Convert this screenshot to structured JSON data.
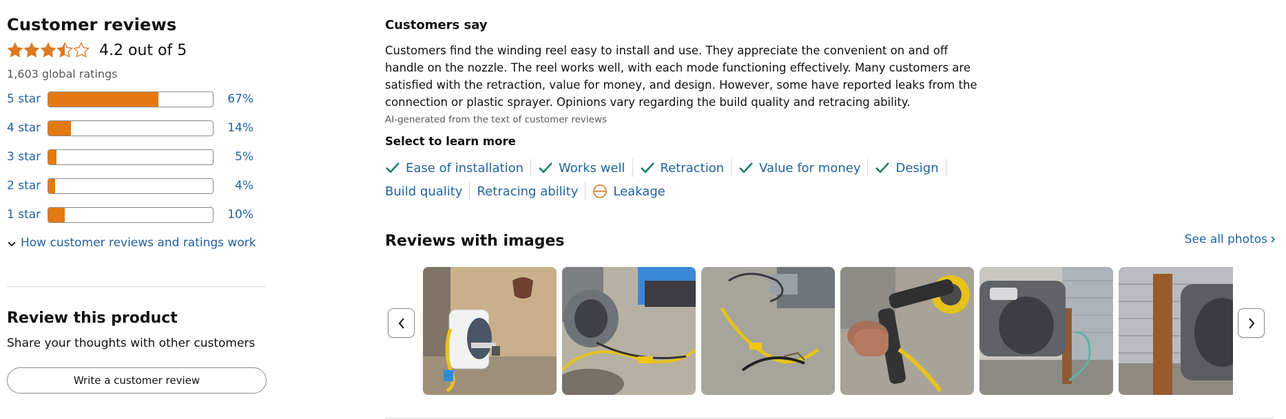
{
  "summary": {
    "title": "Customer reviews",
    "rating_text": "4.2 out of 5",
    "rating_value": 4.2,
    "global_ratings": "1,603 global ratings",
    "histogram": [
      {
        "label": "5 star",
        "pct": "67%",
        "value": 67
      },
      {
        "label": "4 star",
        "pct": "14%",
        "value": 14
      },
      {
        "label": "3 star",
        "pct": "5%",
        "value": 5
      },
      {
        "label": "2 star",
        "pct": "4%",
        "value": 4
      },
      {
        "label": "1 star",
        "pct": "10%",
        "value": 10
      }
    ],
    "how_link": "How customer reviews and ratings work"
  },
  "review_product": {
    "title": "Review this product",
    "subtitle": "Share your thoughts with other customers",
    "button_label": "Write a customer review"
  },
  "customers_say": {
    "title": "Customers say",
    "body": "Customers find the winding reel easy to install and use. They appreciate the convenient on and off handle on the nozzle. The reel works well, with each mode functioning effectively. Many customers are satisfied with the retraction, value for money, and design. However, some have reported leaks from the connection or plastic sprayer. Opinions vary regarding the build quality and retracing ability.",
    "ai_note": "AI-generated from the text of customer reviews",
    "select_title": "Select to learn more",
    "aspects_line1": [
      {
        "label": "Ease of installation",
        "icon": "check-icon"
      },
      {
        "label": "Works well",
        "icon": "check-icon"
      },
      {
        "label": "Retraction",
        "icon": "check-icon"
      },
      {
        "label": "Value for money",
        "icon": "check-icon"
      },
      {
        "label": "Design",
        "icon": "check-icon"
      }
    ],
    "aspects_line2": [
      {
        "label": "Build quality",
        "icon": ""
      },
      {
        "label": "Retracing ability",
        "icon": ""
      },
      {
        "label": "Leakage",
        "icon": "mixed-sentiment-icon"
      }
    ]
  },
  "reviews_with_images": {
    "title": "Reviews with images",
    "see_all": "See all photos"
  },
  "colors": {
    "star": "#de7921",
    "bar_fill": "#e47911",
    "link": "#2162a1",
    "check": "#067d62",
    "mixed": "#d4873a"
  }
}
